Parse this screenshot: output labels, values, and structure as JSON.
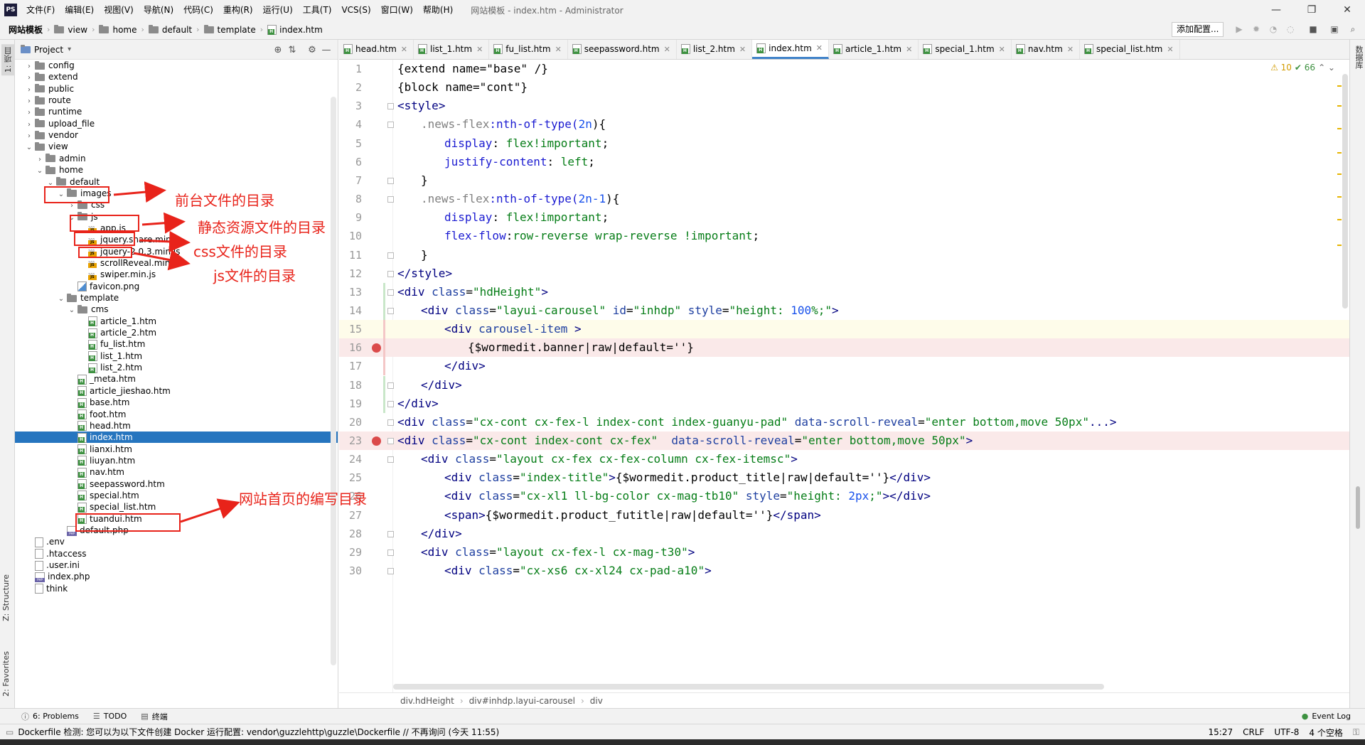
{
  "app": {
    "logo": "PS",
    "title": "网站模板 - index.htm - Administrator",
    "menu": [
      "文件(F)",
      "编辑(E)",
      "视图(V)",
      "导航(N)",
      "代码(C)",
      "重构(R)",
      "运行(U)",
      "工具(T)",
      "VCS(S)",
      "窗口(W)",
      "帮助(H)"
    ],
    "window_controls": {
      "minimize": "—",
      "maximize": "❐",
      "close": "✕"
    }
  },
  "navbar": {
    "crumbs": [
      "网站模板",
      "view",
      "home",
      "default",
      "template",
      "index.htm"
    ],
    "run_config": "添加配置..."
  },
  "left_strip": {
    "project": "1: 项目",
    "structure": "Z: Structure",
    "favorites": "2: Favorites"
  },
  "right_strip": {
    "db": "数据库"
  },
  "project": {
    "title": "Project",
    "tree": [
      {
        "label": "config",
        "depth": 1,
        "type": "folder",
        "arrow": "›"
      },
      {
        "label": "extend",
        "depth": 1,
        "type": "folder",
        "arrow": "›"
      },
      {
        "label": "public",
        "depth": 1,
        "type": "folder",
        "arrow": "›"
      },
      {
        "label": "route",
        "depth": 1,
        "type": "folder",
        "arrow": "›"
      },
      {
        "label": "runtime",
        "depth": 1,
        "type": "folder",
        "arrow": "›"
      },
      {
        "label": "upload_file",
        "depth": 1,
        "type": "folder",
        "arrow": "›"
      },
      {
        "label": "vendor",
        "depth": 1,
        "type": "folder",
        "arrow": "›"
      },
      {
        "label": "view",
        "depth": 1,
        "type": "folder",
        "arrow": "⌄"
      },
      {
        "label": "admin",
        "depth": 2,
        "type": "folder",
        "arrow": "›"
      },
      {
        "label": "home",
        "depth": 2,
        "type": "folder",
        "arrow": "⌄"
      },
      {
        "label": "default",
        "depth": 3,
        "type": "folder",
        "arrow": "⌄"
      },
      {
        "label": "images",
        "depth": 4,
        "type": "folder",
        "arrow": "⌄"
      },
      {
        "label": "css",
        "depth": 5,
        "type": "folder",
        "arrow": "›"
      },
      {
        "label": "js",
        "depth": 5,
        "type": "folder",
        "arrow": "⌄"
      },
      {
        "label": "app.js",
        "depth": 6,
        "type": "js",
        "arrow": ""
      },
      {
        "label": "jquery.share.min.js",
        "depth": 6,
        "type": "js",
        "arrow": ""
      },
      {
        "label": "jquery-2.0.3.min.js",
        "depth": 6,
        "type": "js",
        "arrow": ""
      },
      {
        "label": "scrollReveal.min.js",
        "depth": 6,
        "type": "js",
        "arrow": ""
      },
      {
        "label": "swiper.min.js",
        "depth": 6,
        "type": "js",
        "arrow": ""
      },
      {
        "label": "favicon.png",
        "depth": 5,
        "type": "png",
        "arrow": ""
      },
      {
        "label": "template",
        "depth": 4,
        "type": "folder",
        "arrow": "⌄"
      },
      {
        "label": "cms",
        "depth": 5,
        "type": "folder",
        "arrow": "⌄"
      },
      {
        "label": "article_1.htm",
        "depth": 6,
        "type": "htm",
        "arrow": ""
      },
      {
        "label": "article_2.htm",
        "depth": 6,
        "type": "htm",
        "arrow": ""
      },
      {
        "label": "fu_list.htm",
        "depth": 6,
        "type": "htm",
        "arrow": ""
      },
      {
        "label": "list_1.htm",
        "depth": 6,
        "type": "htm",
        "arrow": ""
      },
      {
        "label": "list_2.htm",
        "depth": 6,
        "type": "htm",
        "arrow": ""
      },
      {
        "label": "_meta.htm",
        "depth": 5,
        "type": "htm",
        "arrow": ""
      },
      {
        "label": "article_jieshao.htm",
        "depth": 5,
        "type": "htm",
        "arrow": ""
      },
      {
        "label": "base.htm",
        "depth": 5,
        "type": "htm",
        "arrow": ""
      },
      {
        "label": "foot.htm",
        "depth": 5,
        "type": "htm",
        "arrow": ""
      },
      {
        "label": "head.htm",
        "depth": 5,
        "type": "htm",
        "arrow": ""
      },
      {
        "label": "index.htm",
        "depth": 5,
        "type": "htm",
        "arrow": "",
        "selected": true
      },
      {
        "label": "lianxi.htm",
        "depth": 5,
        "type": "htm",
        "arrow": ""
      },
      {
        "label": "liuyan.htm",
        "depth": 5,
        "type": "htm",
        "arrow": ""
      },
      {
        "label": "nav.htm",
        "depth": 5,
        "type": "htm",
        "arrow": ""
      },
      {
        "label": "seepassword.htm",
        "depth": 5,
        "type": "htm",
        "arrow": ""
      },
      {
        "label": "special.htm",
        "depth": 5,
        "type": "htm",
        "arrow": ""
      },
      {
        "label": "special_list.htm",
        "depth": 5,
        "type": "htm",
        "arrow": ""
      },
      {
        "label": "tuandui.htm",
        "depth": 5,
        "type": "htm",
        "arrow": ""
      },
      {
        "label": "default.php",
        "depth": 4,
        "type": "php",
        "arrow": ""
      },
      {
        "label": ".env",
        "depth": 1,
        "type": "file",
        "arrow": ""
      },
      {
        "label": ".htaccess",
        "depth": 1,
        "type": "file",
        "arrow": ""
      },
      {
        "label": ".user.ini",
        "depth": 1,
        "type": "file",
        "arrow": ""
      },
      {
        "label": "index.php",
        "depth": 1,
        "type": "php",
        "arrow": ""
      },
      {
        "label": "think",
        "depth": 1,
        "type": "file",
        "arrow": ""
      }
    ]
  },
  "tabs": [
    {
      "label": "head.htm",
      "active": false
    },
    {
      "label": "list_1.htm",
      "active": false
    },
    {
      "label": "fu_list.htm",
      "active": false
    },
    {
      "label": "seepassword.htm",
      "active": false
    },
    {
      "label": "list_2.htm",
      "active": false
    },
    {
      "label": "index.htm",
      "active": true
    },
    {
      "label": "article_1.htm",
      "active": false
    },
    {
      "label": "special_1.htm",
      "active": false
    },
    {
      "label": "nav.htm",
      "active": false
    },
    {
      "label": "special_list.htm",
      "active": false
    }
  ],
  "inspection": {
    "warnings": "⚠ 10",
    "checks": "✔ 66",
    "nav": "⌃ ⌄"
  },
  "editor": {
    "lines": [
      {
        "n": "1",
        "indent": 0,
        "parts": [
          {
            "t": "{extend name=\"base\" /}",
            "c": ""
          }
        ]
      },
      {
        "n": "2",
        "indent": 0,
        "parts": [
          {
            "t": "{block name=\"cont\"}",
            "c": ""
          }
        ]
      },
      {
        "n": "3",
        "indent": 0,
        "fold": true,
        "parts": [
          {
            "t": "<",
            "c": "t-tag"
          },
          {
            "t": "style",
            "c": "t-tag"
          },
          {
            "t": ">",
            "c": "t-tag"
          }
        ]
      },
      {
        "n": "4",
        "indent": 1,
        "fold": true,
        "parts": [
          {
            "t": ".news-flex",
            "c": "t-sel"
          },
          {
            "t": ":nth-of-type(",
            "c": "t-fn"
          },
          {
            "t": "2n",
            "c": "t-num"
          },
          {
            "t": "){",
            "c": ""
          }
        ]
      },
      {
        "n": "5",
        "indent": 2,
        "parts": [
          {
            "t": "display",
            "c": "t-prop"
          },
          {
            "t": ": ",
            "c": ""
          },
          {
            "t": "flex",
            "c": "t-str"
          },
          {
            "t": "!important",
            "c": "t-str"
          },
          {
            "t": ";",
            "c": ""
          }
        ]
      },
      {
        "n": "6",
        "indent": 2,
        "parts": [
          {
            "t": "justify-content",
            "c": "t-prop"
          },
          {
            "t": ": ",
            "c": ""
          },
          {
            "t": "left",
            "c": "t-str"
          },
          {
            "t": ";",
            "c": ""
          }
        ]
      },
      {
        "n": "7",
        "indent": 1,
        "fold": true,
        "parts": [
          {
            "t": "}",
            "c": ""
          }
        ]
      },
      {
        "n": "8",
        "indent": 1,
        "fold": true,
        "parts": [
          {
            "t": ".news-flex",
            "c": "t-sel"
          },
          {
            "t": ":nth-of-type(",
            "c": "t-fn"
          },
          {
            "t": "2n-1",
            "c": "t-num"
          },
          {
            "t": "){",
            "c": ""
          }
        ]
      },
      {
        "n": "9",
        "indent": 2,
        "parts": [
          {
            "t": "display",
            "c": "t-prop"
          },
          {
            "t": ": ",
            "c": ""
          },
          {
            "t": "flex",
            "c": "t-str"
          },
          {
            "t": "!important",
            "c": "t-str"
          },
          {
            "t": ";",
            "c": ""
          }
        ]
      },
      {
        "n": "10",
        "indent": 2,
        "parts": [
          {
            "t": "flex-flow",
            "c": "t-prop"
          },
          {
            "t": ":",
            "c": ""
          },
          {
            "t": "row-reverse wrap-reverse ",
            "c": "t-str"
          },
          {
            "t": "!important",
            "c": "t-str"
          },
          {
            "t": ";",
            "c": ""
          }
        ]
      },
      {
        "n": "11",
        "indent": 1,
        "fold": true,
        "parts": [
          {
            "t": "}",
            "c": ""
          }
        ]
      },
      {
        "n": "12",
        "indent": 0,
        "fold": true,
        "parts": [
          {
            "t": "</",
            "c": "t-tag"
          },
          {
            "t": "style",
            "c": "t-tag"
          },
          {
            "t": ">",
            "c": "t-tag"
          }
        ]
      },
      {
        "n": "13",
        "indent": 0,
        "fold": true,
        "chg": true,
        "parts": [
          {
            "t": "<div ",
            "c": "t-tag"
          },
          {
            "t": "class",
            "c": "t-attr"
          },
          {
            "t": "=",
            "c": ""
          },
          {
            "t": "\"hdHeight\"",
            "c": "t-str"
          },
          {
            "t": ">",
            "c": "t-tag"
          }
        ]
      },
      {
        "n": "14",
        "indent": 1,
        "fold": true,
        "chg": true,
        "parts": [
          {
            "t": "<div ",
            "c": "t-tag"
          },
          {
            "t": "class",
            "c": "t-attr"
          },
          {
            "t": "=",
            "c": ""
          },
          {
            "t": "\"layui-carousel\"",
            "c": "t-str"
          },
          {
            "t": " id",
            "c": "t-attr"
          },
          {
            "t": "=",
            "c": ""
          },
          {
            "t": "\"inhdp\"",
            "c": "t-str"
          },
          {
            "t": " style",
            "c": "t-attr"
          },
          {
            "t": "=",
            "c": ""
          },
          {
            "t": "\"height: ",
            "c": "t-str"
          },
          {
            "t": "100",
            "c": "t-num"
          },
          {
            "t": "%;\"",
            "c": "t-str"
          },
          {
            "t": ">",
            "c": "t-tag"
          }
        ]
      },
      {
        "n": "15",
        "indent": 2,
        "cur": true,
        "del": true,
        "parts": [
          {
            "t": "<div ",
            "c": "t-tag"
          },
          {
            "t": "carousel-item",
            "c": "t-attr"
          },
          {
            "t": " >",
            "c": "t-tag"
          }
        ]
      },
      {
        "n": "16",
        "indent": 3,
        "bp": true,
        "del": true,
        "parts": [
          {
            "t": "{$wormedit.banner|raw|default=''}",
            "c": ""
          }
        ]
      },
      {
        "n": "17",
        "indent": 2,
        "del": true,
        "parts": [
          {
            "t": "</div>",
            "c": "t-tag"
          }
        ]
      },
      {
        "n": "18",
        "indent": 1,
        "fold": true,
        "chg": true,
        "parts": [
          {
            "t": "</div>",
            "c": "t-tag"
          }
        ]
      },
      {
        "n": "19",
        "indent": 0,
        "fold": true,
        "chg": true,
        "parts": [
          {
            "t": "</div>",
            "c": "t-tag"
          }
        ]
      },
      {
        "n": "20",
        "indent": 0,
        "fold": true,
        "parts": [
          {
            "t": "<div ",
            "c": "t-tag"
          },
          {
            "t": "class",
            "c": "t-attr"
          },
          {
            "t": "=",
            "c": ""
          },
          {
            "t": "\"cx-cont cx-fex-l index-cont index-guanyu-pad\"",
            "c": "t-str"
          },
          {
            "t": " data-scroll-reveal",
            "c": "t-attr"
          },
          {
            "t": "=",
            "c": ""
          },
          {
            "t": "\"enter bottom,move 50px\"",
            "c": "t-str"
          },
          {
            "t": "...>",
            "c": "t-tag"
          }
        ]
      },
      {
        "n": "23",
        "indent": 0,
        "bp": true,
        "fold": true,
        "parts": [
          {
            "t": "<div ",
            "c": "t-tag"
          },
          {
            "t": "class",
            "c": "t-attr"
          },
          {
            "t": "=",
            "c": ""
          },
          {
            "t": "\"cx-cont index-cont cx-fex\"",
            "c": "t-str"
          },
          {
            "t": "  data-scroll-reveal",
            "c": "t-attr"
          },
          {
            "t": "=",
            "c": ""
          },
          {
            "t": "\"enter bottom,move 50px\"",
            "c": "t-str"
          },
          {
            "t": ">",
            "c": "t-tag"
          }
        ]
      },
      {
        "n": "24",
        "indent": 1,
        "fold": true,
        "parts": [
          {
            "t": "<div ",
            "c": "t-tag"
          },
          {
            "t": "class",
            "c": "t-attr"
          },
          {
            "t": "=",
            "c": ""
          },
          {
            "t": "\"layout cx-fex cx-fex-column cx-fex-itemsc\"",
            "c": "t-str"
          },
          {
            "t": ">",
            "c": "t-tag"
          }
        ]
      },
      {
        "n": "25",
        "indent": 2,
        "parts": [
          {
            "t": "<div ",
            "c": "t-tag"
          },
          {
            "t": "class",
            "c": "t-attr"
          },
          {
            "t": "=",
            "c": ""
          },
          {
            "t": "\"index-title\"",
            "c": "t-str"
          },
          {
            "t": ">",
            "c": "t-tag"
          },
          {
            "t": "{$wormedit.product_title|raw|default=''}",
            "c": ""
          },
          {
            "t": "</div>",
            "c": "t-tag"
          }
        ]
      },
      {
        "n": "26",
        "indent": 2,
        "parts": [
          {
            "t": "<div ",
            "c": "t-tag"
          },
          {
            "t": "class",
            "c": "t-attr"
          },
          {
            "t": "=",
            "c": ""
          },
          {
            "t": "\"cx-xl1 ll-bg-color cx-mag-tb10\"",
            "c": "t-str"
          },
          {
            "t": " style",
            "c": "t-attr"
          },
          {
            "t": "=",
            "c": ""
          },
          {
            "t": "\"height: ",
            "c": "t-str"
          },
          {
            "t": "2px",
            "c": "t-num"
          },
          {
            "t": ";\"",
            "c": "t-str"
          },
          {
            "t": "></div>",
            "c": "t-tag"
          }
        ]
      },
      {
        "n": "27",
        "indent": 2,
        "parts": [
          {
            "t": "<span>",
            "c": "t-tag"
          },
          {
            "t": "{$wormedit.product_futitle|raw|default=''}",
            "c": ""
          },
          {
            "t": "</span>",
            "c": "t-tag"
          }
        ]
      },
      {
        "n": "28",
        "indent": 1,
        "fold": true,
        "parts": [
          {
            "t": "</div>",
            "c": "t-tag"
          }
        ]
      },
      {
        "n": "29",
        "indent": 1,
        "fold": true,
        "parts": [
          {
            "t": "<div ",
            "c": "t-tag"
          },
          {
            "t": "class",
            "c": "t-attr"
          },
          {
            "t": "=",
            "c": ""
          },
          {
            "t": "\"layout cx-fex-l cx-mag-t30\"",
            "c": "t-str"
          },
          {
            "t": ">",
            "c": "t-tag"
          }
        ]
      },
      {
        "n": "30",
        "indent": 2,
        "fold": true,
        "parts": [
          {
            "t": "<div ",
            "c": "t-tag"
          },
          {
            "t": "class",
            "c": "t-attr"
          },
          {
            "t": "=",
            "c": ""
          },
          {
            "t": "\"cx-xs6 cx-xl24 cx-pad-a10\"",
            "c": "t-str"
          },
          {
            "t": ">",
            "c": "t-tag"
          }
        ]
      }
    ]
  },
  "breadbar": [
    "div.hdHeight",
    "div#inhdp.layui-carousel",
    "div"
  ],
  "toolwindows": {
    "problems": "6: Problems",
    "todo": "TODO",
    "terminal": "终端",
    "event_log": "Event Log"
  },
  "status": {
    "message": "Dockerfile 检测: 您可以为以下文件创建 Docker 运行配置: vendor\\guzzlehttp\\guzzle\\Dockerfile // 不再询问 (今天 11:55)",
    "position": "15:27",
    "line_sep": "CRLF",
    "encoding": "UTF-8",
    "indent": "4 个空格"
  },
  "annotations": {
    "home": "前台文件的目录",
    "images": "静态资源文件的目录",
    "css": "css文件的目录",
    "js": "js文件的目录",
    "index": "网站首页的编写目录"
  },
  "colors": {
    "annotation": "#e8231a",
    "selection": "#2675bf",
    "active_tab": "#4083c9"
  }
}
